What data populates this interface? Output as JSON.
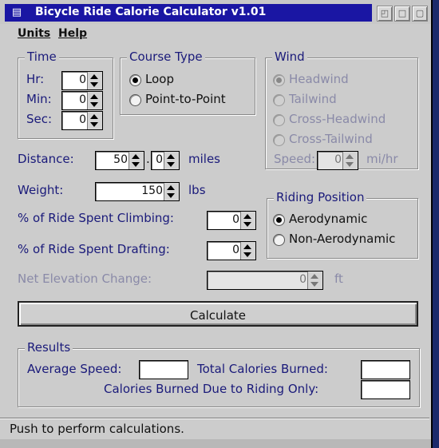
{
  "window": {
    "title": "Bicycle Ride Calorie Calculator  v1.01"
  },
  "menu": {
    "items": [
      "Units",
      "Help"
    ]
  },
  "time": {
    "legend": "Time",
    "hr_label": "Hr:",
    "hr_value": "0",
    "min_label": "Min:",
    "min_value": "0",
    "sec_label": "Sec:",
    "sec_value": "0"
  },
  "course": {
    "legend": "Course Type",
    "options": [
      "Loop",
      "Point-to-Point"
    ],
    "selected": "Loop"
  },
  "wind": {
    "legend": "Wind",
    "options": [
      "Headwind",
      "Tailwind",
      "Cross-Headwind",
      "Cross-Tailwind"
    ],
    "selected": "Headwind",
    "speed_label": "Speed:",
    "speed_value": "0",
    "speed_unit": "mi/hr"
  },
  "distance": {
    "label": "Distance:",
    "whole": "50",
    "dot": ".",
    "fraction": "0",
    "unit": "miles"
  },
  "weight": {
    "label": "Weight:",
    "value": "150",
    "unit": "lbs"
  },
  "climbing": {
    "label": "% of Ride Spent Climbing:",
    "value": "0"
  },
  "drafting": {
    "label": "% of Ride Spent Drafting:",
    "value": "0"
  },
  "elevation": {
    "label": "Net Elevation Change:",
    "value": "0",
    "unit": "ft"
  },
  "position": {
    "legend": "Riding Position",
    "options": [
      "Aerodynamic",
      "Non-Aerodynamic"
    ],
    "selected": "Aerodynamic"
  },
  "calculate": {
    "label": "Calculate"
  },
  "results": {
    "legend": "Results",
    "avg_speed_label": "Average Speed:",
    "avg_speed_value": "",
    "total_calories_label": "Total Calories Burned:",
    "total_calories_value": "",
    "riding_calories_label": "Calories Burned Due to Riding Only:",
    "riding_calories_value": ""
  },
  "status": {
    "text": "Push to perform calculations."
  },
  "colors": {
    "title_bar": "#1a16a3",
    "label_text": "#1a1a7a",
    "background": "#cccccc",
    "desktop": "#1b2a6b"
  }
}
